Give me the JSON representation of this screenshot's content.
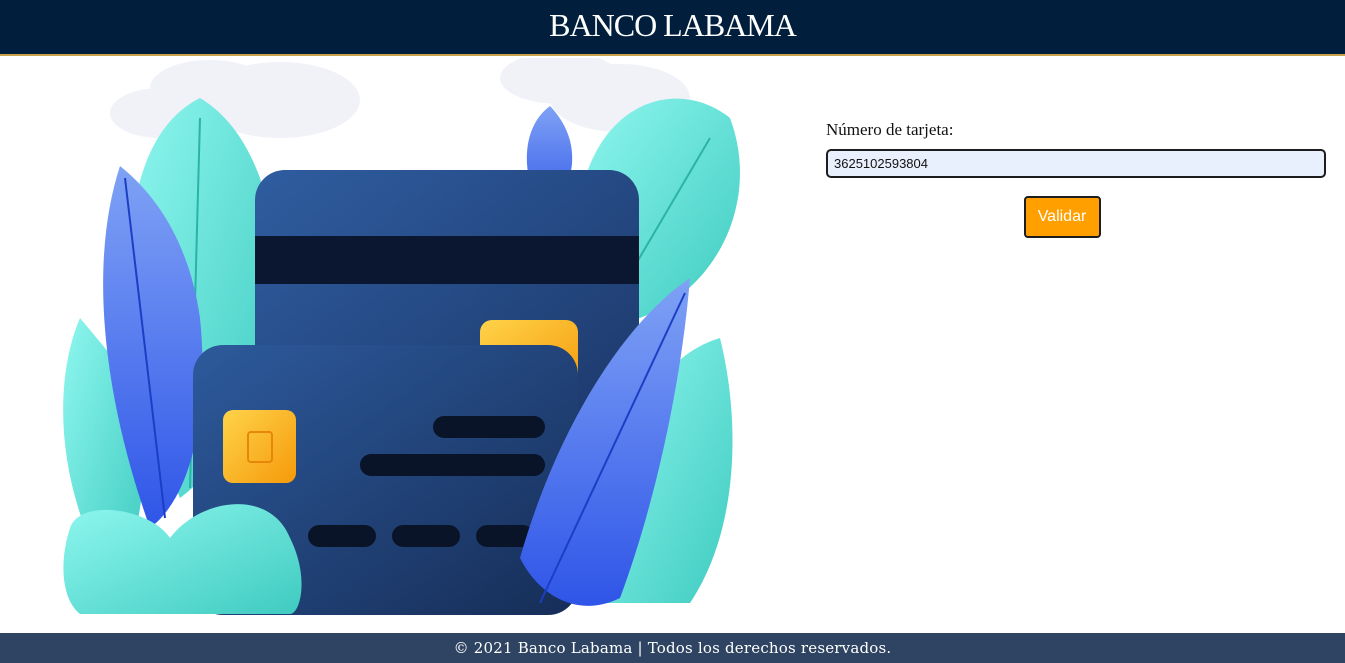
{
  "header": {
    "title": "BANCO LABAMA"
  },
  "form": {
    "card_label": "Número de tarjeta:",
    "card_value": "3625102593804",
    "submit_label": "Validar"
  },
  "footer": {
    "text": "© 2021 Banco Labama | Todos los derechos reservados."
  },
  "colors": {
    "header_bg": "#011f3c",
    "footer_bg": "#2e4462",
    "button_bg": "#ffa000",
    "input_bg": "#e8f0fe"
  }
}
